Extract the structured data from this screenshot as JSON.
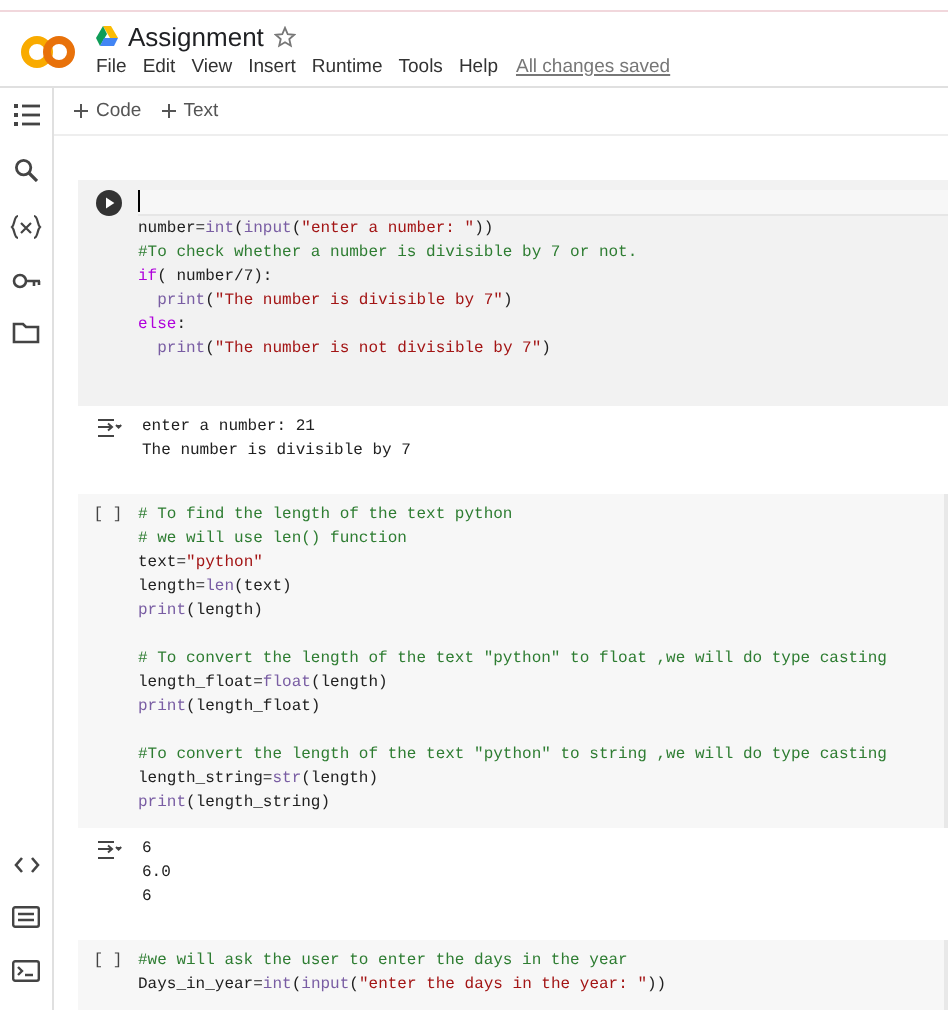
{
  "notebook": {
    "title": "Assignment",
    "starred": false
  },
  "menu": [
    "File",
    "Edit",
    "View",
    "Insert",
    "Runtime",
    "Tools",
    "Help"
  ],
  "save_status": "All changes saved",
  "toolbar": [
    {
      "label": "Code"
    },
    {
      "label": "Text"
    }
  ],
  "cells": [
    {
      "selected": true,
      "blocks": [
        [
          [
            {
              "text": "number=",
              "kind": "plain"
            },
            {
              "text": "int",
              "kind": "builtin"
            },
            {
              "text": "(",
              "kind": "plain"
            },
            {
              "text": "input",
              "kind": "builtin"
            },
            {
              "text": "(",
              "kind": "plain"
            },
            {
              "text": "\"enter a number: \"",
              "kind": "string"
            },
            {
              "text": "))",
              "kind": "plain"
            }
          ],
          [
            {
              "text": "#To check whether a number is divisible by 7 or not.",
              "kind": "comment"
            }
          ],
          [
            {
              "text": "if",
              "kind": "keyword"
            },
            {
              "text": "( number/7):",
              "kind": "plain"
            }
          ],
          [
            {
              "kind": "indent"
            },
            {
              "text": "print",
              "kind": "builtin"
            },
            {
              "text": "(",
              "kind": "plain"
            },
            {
              "text": "\"The number is divisible by 7\"",
              "kind": "string"
            },
            {
              "text": ")",
              "kind": "plain"
            }
          ],
          [
            {
              "text": "else",
              "kind": "keyword"
            },
            {
              "text": ":",
              "kind": "plain"
            }
          ],
          [
            {
              "kind": "indent"
            },
            {
              "text": "print",
              "kind": "builtin"
            },
            {
              "text": "(",
              "kind": "plain"
            },
            {
              "text": "\"The number is not divisible by 7\"",
              "kind": "string"
            },
            {
              "text": ")",
              "kind": "plain"
            }
          ]
        ]
      ],
      "output": [
        "enter a number: 21",
        "The number is divisible by 7"
      ]
    },
    {
      "selected": false,
      "prompt": "[ ]",
      "blocks": [
        [
          [
            {
              "text": "# To find the length of the text python",
              "kind": "comment"
            }
          ],
          [
            {
              "text": "# we will use len() function",
              "kind": "comment"
            }
          ],
          [
            {
              "text": "text=",
              "kind": "plain"
            },
            {
              "text": "\"python\"",
              "kind": "string"
            }
          ],
          [
            {
              "text": "length=",
              "kind": "plain"
            },
            {
              "text": "len",
              "kind": "builtin"
            },
            {
              "text": "(text)",
              "kind": "plain"
            }
          ],
          [
            {
              "text": "print",
              "kind": "builtin"
            },
            {
              "text": "(length)",
              "kind": "plain"
            }
          ]
        ],
        [
          [
            {
              "text": "# To convert the length of the text \"python\" to float ,we will do type casting",
              "kind": "comment"
            }
          ],
          [
            {
              "text": "length_float=",
              "kind": "plain"
            },
            {
              "text": "float",
              "kind": "builtin"
            },
            {
              "text": "(length)",
              "kind": "plain"
            }
          ],
          [
            {
              "text": "print",
              "kind": "builtin"
            },
            {
              "text": "(length_float)",
              "kind": "plain"
            }
          ]
        ],
        [
          [
            {
              "text": "#To convert the length of the text \"python\" to string ,we will do type casting",
              "kind": "comment"
            }
          ],
          [
            {
              "text": "length_string=",
              "kind": "plain"
            },
            {
              "text": "str",
              "kind": "builtin"
            },
            {
              "text": "(length)",
              "kind": "plain"
            }
          ],
          [
            {
              "text": "print",
              "kind": "builtin"
            },
            {
              "text": "(length_string)",
              "kind": "plain"
            }
          ]
        ]
      ],
      "output": [
        "6",
        "6.0",
        "6"
      ]
    },
    {
      "selected": false,
      "prompt": "[ ]",
      "blocks": [
        [
          [
            {
              "text": "#we will ask the user to enter the days in the year",
              "kind": "comment"
            }
          ],
          [
            {
              "text": "Days_in_year=",
              "kind": "plain"
            },
            {
              "text": "int",
              "kind": "builtin"
            },
            {
              "text": "(",
              "kind": "plain"
            },
            {
              "text": "input",
              "kind": "builtin"
            },
            {
              "text": "(",
              "kind": "plain"
            },
            {
              "text": "\"enter the days in the year: \"",
              "kind": "string"
            },
            {
              "text": "))",
              "kind": "plain"
            }
          ]
        ]
      ]
    }
  ]
}
